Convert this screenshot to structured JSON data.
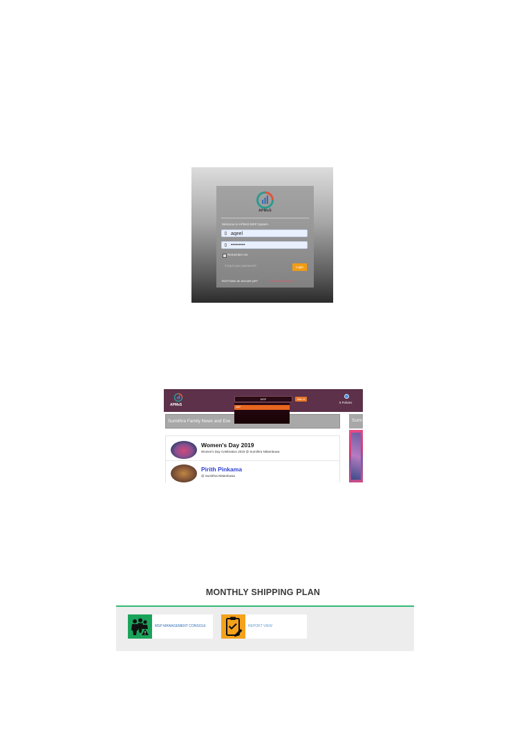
{
  "login": {
    "logo_text": "APMsS",
    "welcome": "Welcome to APMsS MSP System",
    "username_value": "aqeel",
    "password_value": "•••••••••",
    "remember_label": "Remember me",
    "forgot_label": "Forgot your password?",
    "login_button": "Login",
    "no_account": "Don't have an account yet?",
    "create_account": "Create an account",
    "colors": {
      "accent": "#f39c12",
      "link": "#e25a6a"
    }
  },
  "dashboard": {
    "logo_text": "APMsS",
    "search_value": "MSP",
    "filter_button": "filter ▾",
    "dropdown_item": "MSP",
    "policies_label": "5 Policies",
    "news_header": "Sumithra Family News and Eve",
    "right_header": "Sumi",
    "news": [
      {
        "title": "Women's Day 2019",
        "subtitle": "Women's Day Celebration 2019 @ Sumithra Nittambuwa"
      },
      {
        "title": "Pirith Pinkama",
        "subtitle": "@ Sumithra Nittambuwa"
      }
    ],
    "colors": {
      "header": "#5c3149",
      "accent": "#e8792a"
    }
  },
  "shipping_plan": {
    "title": "MONTHLY SHIPPING PLAN",
    "tiles": [
      {
        "label": "MSP MANAGEMENT CONSOLE",
        "icon": "people-alert-icon",
        "color": "#1aa35a"
      },
      {
        "label": "REPORT VIEW",
        "icon": "clipboard-check-icon",
        "color": "#f4a21c"
      }
    ],
    "colors": {
      "rule": "#2fb873"
    }
  }
}
